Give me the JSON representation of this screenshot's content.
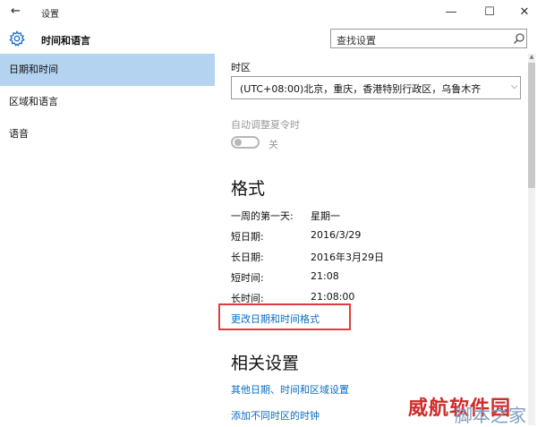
{
  "window": {
    "back_icon": "arrow-left-icon",
    "title": "设置",
    "minimize_glyph": "—",
    "maximize_glyph": "☐",
    "close_glyph": "✕"
  },
  "header": {
    "icon": "gear-icon",
    "title": "时间和语言",
    "search_placeholder": "查找设置"
  },
  "sidebar": {
    "items": [
      {
        "label": "日期和时间",
        "active": true
      },
      {
        "label": "区域和语言",
        "active": false
      },
      {
        "label": "语音",
        "active": false
      }
    ]
  },
  "main": {
    "timezone_label": "时区",
    "timezone_value": "(UTC+08:00)北京，重庆，香港特别行政区，乌鲁木齐",
    "dst_label": "自动调整夏令时",
    "dst_toggle_text": "关",
    "dst_on": false,
    "format_heading": "格式",
    "format_rows": [
      {
        "key": "一周的第一天:",
        "value": "星期一"
      },
      {
        "key": "短日期:",
        "value": "2016/3/29"
      },
      {
        "key": "长日期:",
        "value": "2016年3月29日"
      },
      {
        "key": "短时间:",
        "value": "21:08"
      },
      {
        "key": "长时间:",
        "value": "21:08:00"
      }
    ],
    "change_format_link": "更改日期和时间格式",
    "related_heading": "相关设置",
    "related_links": [
      "其他日期、时间和区域设置",
      "添加不同时区的时钟"
    ]
  },
  "watermark": {
    "brand": "威航软件园",
    "site": "脚本之家"
  },
  "colors": {
    "accent_link": "#0b6cc4",
    "selected_nav": "#b3d3f0",
    "highlight_box": "#e23b3b"
  }
}
